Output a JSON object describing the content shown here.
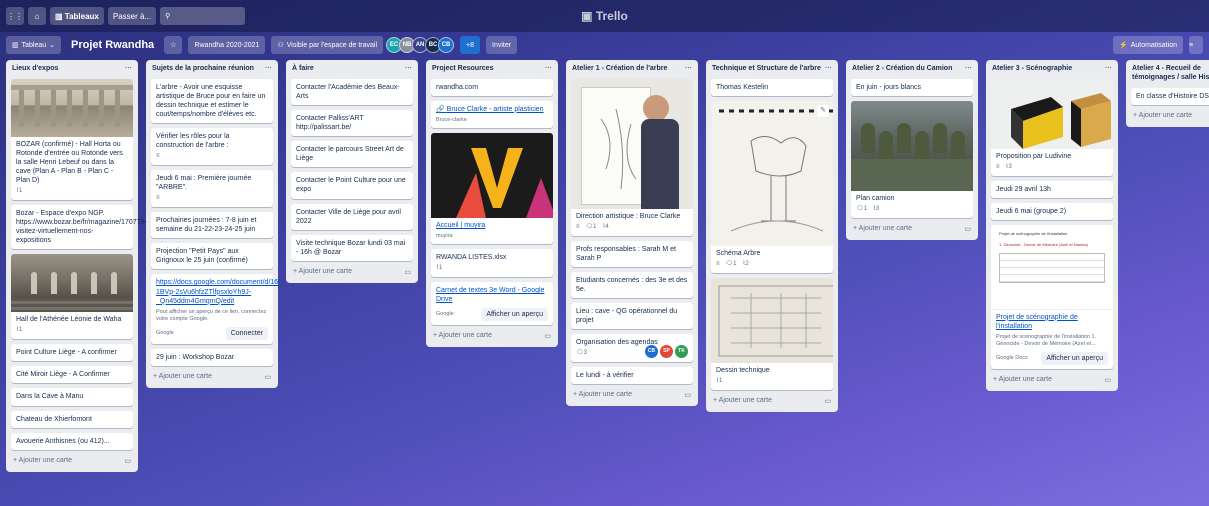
{
  "topbar": {
    "boards_label": "Tableaux",
    "jump_label": "Passer à...",
    "logo": "Trello"
  },
  "boardbar": {
    "view_label": "Tableau",
    "board_name": "Projet Rwandha",
    "workspace": "Rwandha 2020-2021",
    "visibility": "Visible par l'espace de travail",
    "more_members": "+8",
    "invite": "Inviter",
    "automation": "Automatisation",
    "avatars": [
      {
        "initials": "EC",
        "color": "#1fa3b0"
      },
      {
        "initials": "NB",
        "color": "#8a8fa0"
      },
      {
        "initials": "AN",
        "color": "#3b3f8f"
      },
      {
        "initials": "BC",
        "color": "#172b4d"
      },
      {
        "initials": "CB",
        "color": "#1f6fd0"
      }
    ]
  },
  "colors": {
    "green": "#61bd4f",
    "red": "#eb5a46",
    "blue": "#0079bf"
  },
  "lists": [
    {
      "title": "Lieux d'expos",
      "add": "+ Ajouter une carte",
      "cards": [
        {
          "text": "BOZAR (confirmé) - Hall Horta ou Rotonde d'entrée ou Rotonde vers la salle Henri Lebeuf ou dans la cave (Plan A - Plan B - Plan C - Plan D)",
          "attach": "1"
        },
        {
          "text": "Bozar - Espace d'expo NGP. https://www.bozar.be/fr/magazine/170779-visitez-virtuellement-nos-expositions"
        },
        {
          "text": "Hall de l'Athénée Léonie de Waha",
          "attach": "1"
        },
        {
          "text": "Point Culture Liège - A confirmer"
        },
        {
          "text": "Cité Miroir Liège - A Confirmer"
        },
        {
          "text": "Dans la Cave à Manu"
        },
        {
          "text": "Chateau de Xhierfomont"
        },
        {
          "text": "Avouerie Anthisnes (ou 412)..."
        }
      ]
    },
    {
      "title": "Sujets de la prochaine réunion",
      "add": "+ Ajouter une carte",
      "cards": [
        {
          "text": "L'arbre - Avoir une esquisse artistique de Bruce pour en faire un dessin technique et estimer le cout/temps/nombre d'élèves etc."
        },
        {
          "text": "Vérifier les rôles pour la construction de l'arbre :",
          "desc": "≡"
        },
        {
          "text": "Jeudi 6 mai : Première journée \"ARBRE\".",
          "desc": "≡"
        },
        {
          "text": "Prochaines journées : 7-8 juin et semaine du 21-22-23-24-25 juin"
        },
        {
          "text": "Projection \"Petit Pays\" aux Grignoux le 25 juin (confirmé)"
        },
        {
          "link": "https://docs.google.com/document/d/16-1BVp-2sVu6hfzZTlfpsxloYh9J-_Qn45ddm4GmqmQ/edit",
          "note": "Pour afficher un aperçu de ce lien, connectez votre compte Google.",
          "source": "Google",
          "button": "Connecter"
        },
        {
          "text": "29 juin : Workshop Bozar"
        }
      ]
    },
    {
      "title": "À faire",
      "add": "+ Ajouter une carte",
      "cards": [
        {
          "text": "Contacter l'Académie des Beaux-Arts"
        },
        {
          "text": "Contacter Palliss'ART http://palissart.be/"
        },
        {
          "text": "Contacter le parcours Street Art de Liège"
        },
        {
          "text": "Contacter le Point Culture pour une expo"
        },
        {
          "text": "Contacter Ville de Liège pour avril 2022"
        },
        {
          "text": "Visite technique Bozar lundi 03 mai - 16h @ Bozar"
        }
      ]
    },
    {
      "title": "Project Resources",
      "add": "+ Ajouter une carte",
      "cards": [
        {
          "text": "rwandha.com"
        },
        {
          "link": "Bruce Clarke - artiste plasticien",
          "source": "Bruce-clarke"
        },
        {
          "link": "Accueil | muyira",
          "source": "muyira"
        },
        {
          "text": "RWANDA LISTES.xlsx",
          "attach": "1"
        },
        {
          "link": "Carnet de textes 3e Word - Google Drive",
          "source": "Google",
          "button": "Afficher un aperçu"
        }
      ]
    },
    {
      "title": "Atelier 1 - Création de l'arbre",
      "add": "+ Ajouter une carte",
      "cards": [
        {
          "text": "Direction artistique : Bruce Clarke",
          "desc": "≡",
          "comments": "1",
          "attach": "4"
        },
        {
          "text": "Profs responsables : Sarah M et Sarah P"
        },
        {
          "text": "Etudiants concernés : des 3e et des 5e."
        },
        {
          "text": "Lieu : cave - QG opérationnel du projet"
        },
        {
          "text": "Organisation des agendas",
          "comments": "3",
          "members": [
            {
              "i": "CB",
              "c": "#1f6fd0"
            },
            {
              "i": "SP",
              "c": "#e0483a"
            },
            {
              "i": "TK",
              "c": "#2e9e57"
            }
          ]
        },
        {
          "text": "Le lundi - à vérifier"
        }
      ]
    },
    {
      "title": "Technique et Structure de l'arbre",
      "add": "+ Ajouter une carte",
      "cards": [
        {
          "text": "Thomas Kestelin"
        },
        {
          "text": "Schéma Arbre",
          "desc": "≡",
          "comments": "1",
          "attach": "2"
        },
        {
          "text": "Dessin technique",
          "attach": "1"
        }
      ]
    },
    {
      "title": "Atelier 2 - Création du Camion",
      "add": "+ Ajouter une carte",
      "cards": [
        {
          "text": "En juin - jours blancs"
        },
        {
          "text": "Plan camion",
          "comments": "1",
          "attach": "3"
        }
      ]
    },
    {
      "title": "Atelier 3 - Scénographie",
      "add": "+ Ajouter une carte",
      "cards": [
        {
          "text": "Proposition par Ludivine",
          "desc": "≡",
          "attach": "3"
        },
        {
          "text": "Jeudi 29 avril 13h"
        },
        {
          "text": "Jeudi 6 mai (groupe 2)"
        },
        {
          "link": "Projet de scénographie de l'installation",
          "note": "Projet de scénographie de l'installation 1. Génocide - Devoir de Mémoire (Azel et...",
          "source": "Google Docs",
          "button": "Afficher un aperçu",
          "doc_title": "Projet de scénographie de l'installation",
          "doc_line": "1. Génocide - Devoir de Mémoire (Azel et Naoma)"
        }
      ]
    },
    {
      "title": "Atelier 4 - Recueil de témoignages / salle Histo",
      "add": "+ Ajouter une carte",
      "cards": [
        {
          "text": "En classe d'Histoire DS ?"
        }
      ]
    }
  ]
}
